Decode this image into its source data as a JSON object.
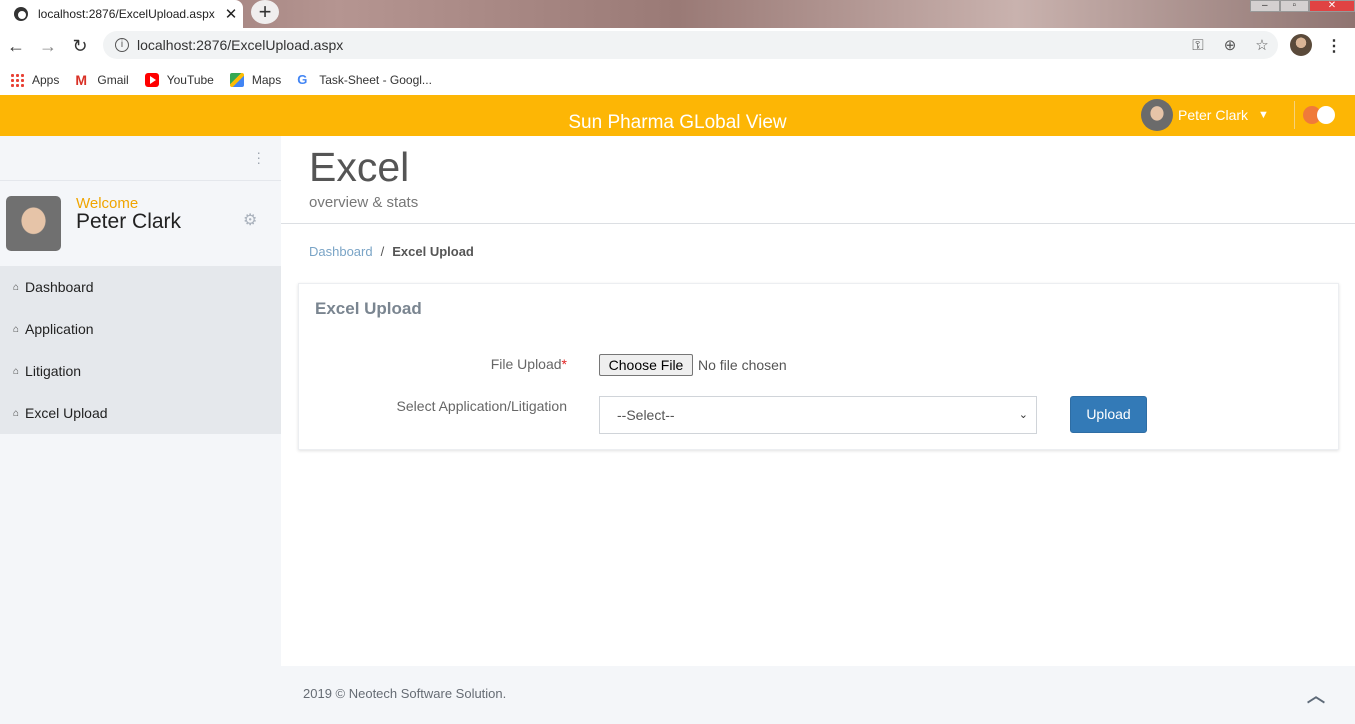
{
  "browser": {
    "tab_title": "localhost:2876/ExcelUpload.aspx",
    "tab_close": "✕",
    "new_tab": "+",
    "url": "localhost:2876/ExcelUpload.aspx",
    "bookmarks": [
      {
        "label": "Apps",
        "icon": "apps-grid-icon"
      },
      {
        "label": "Gmail",
        "icon": "gmail-icon"
      },
      {
        "label": "YouTube",
        "icon": "youtube-icon"
      },
      {
        "label": "Maps",
        "icon": "maps-icon"
      },
      {
        "label": "Task-Sheet - Googl...",
        "icon": "google-icon"
      }
    ]
  },
  "header": {
    "title": "Sun Pharma GLobal View",
    "user_name": "Peter Clark",
    "accent_color": "#fdb605"
  },
  "sidebar": {
    "welcome": "Welcome",
    "user_name": "Peter Clark",
    "items": [
      {
        "label": "Dashboard",
        "icon": "home-icon"
      },
      {
        "label": "Application",
        "icon": "home-icon"
      },
      {
        "label": "Litigation",
        "icon": "home-icon"
      },
      {
        "label": "Excel Upload",
        "icon": "home-icon"
      }
    ]
  },
  "page": {
    "title": "Excel",
    "subtitle": "overview & stats",
    "breadcrumb": {
      "home": "Dashboard",
      "separator": "/",
      "current": "Excel Upload"
    }
  },
  "form": {
    "panel_title": "Excel Upload",
    "file_label": "File Upload",
    "required_mark": "*",
    "choose_file": "Choose File",
    "file_status": "No file chosen",
    "select_label": "Select Application/Litigation",
    "select_value": "--Select--",
    "upload_button": "Upload",
    "button_color": "#337ab7"
  },
  "footer": {
    "text": "2019 © Neotech Software Solution."
  }
}
